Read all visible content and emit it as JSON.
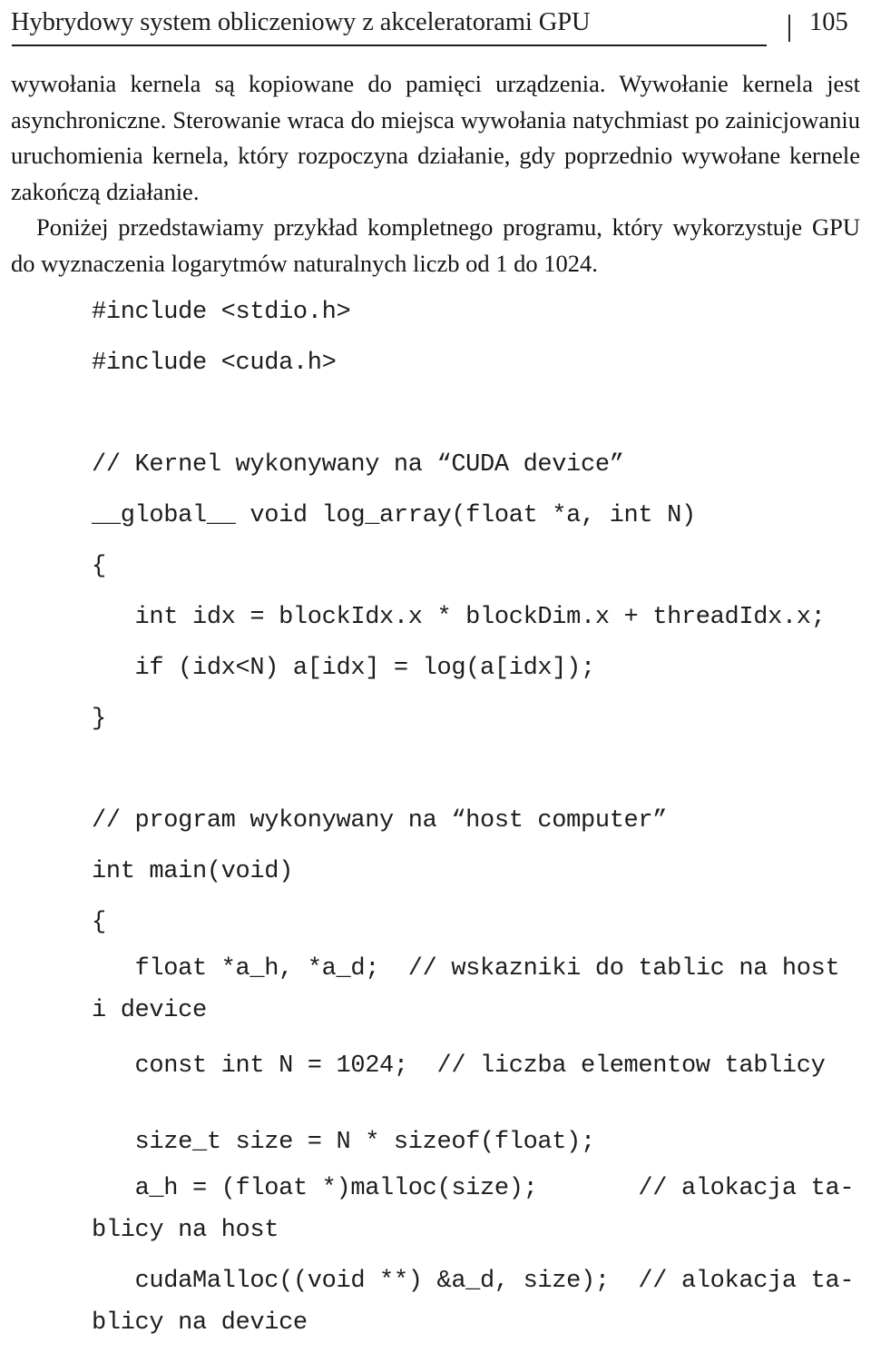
{
  "running_head": {
    "title": "Hybrydowy system obliczeniowy z akceleratorami GPU",
    "separator": "|",
    "page_number": "105"
  },
  "body": {
    "paragraphs": [
      {
        "indent": false,
        "text": "wywołania kernela są kopiowane do pamięci urządzenia. Wywołanie kernela jest asynchroniczne. Sterowanie wraca do miejsca wywołania natychmiast po zainicjowaniu uruchomienia kernela, który rozpoczyna działanie, gdy poprzednio wywołane kernele zakończą działanie."
      },
      {
        "indent": true,
        "text": "Poniżej przedstawiamy przykład kompletnego programu, który wykorzystuje GPU do wyznaczenia logarytmów naturalnych liczb od 1 do 1024."
      }
    ]
  },
  "listing": {
    "language": "CUDA C",
    "lines": [
      {
        "id": "l01",
        "text": "#include <stdio.h>",
        "kind": "code"
      },
      {
        "id": "l02",
        "text": "#include <cuda.h>",
        "kind": "code"
      },
      {
        "id": "l03",
        "text": "",
        "kind": "blank"
      },
      {
        "id": "l04",
        "text": "// Kernel wykonywany na “CUDA device”",
        "kind": "comment"
      },
      {
        "id": "l05",
        "text": "__global__ void log_array(float *a, int N)",
        "kind": "code"
      },
      {
        "id": "l06",
        "text": "{",
        "kind": "code"
      },
      {
        "id": "l07",
        "text": "   int idx = blockIdx.x * blockDim.x + threadIdx.x;",
        "kind": "code"
      },
      {
        "id": "l08",
        "text": "   if (idx<N) a[idx] = log(a[idx]);",
        "kind": "code"
      },
      {
        "id": "l09",
        "text": "}",
        "kind": "code"
      },
      {
        "id": "l10",
        "text": "",
        "kind": "blank"
      },
      {
        "id": "l11",
        "text": "// program wykonywany na “host computer”",
        "kind": "comment"
      },
      {
        "id": "l12",
        "text": "int main(void)",
        "kind": "code"
      },
      {
        "id": "l13",
        "text": "{",
        "kind": "code"
      },
      {
        "id": "l14",
        "text": "   float *a_h, *a_d;  // wskazniki do tablic na host i device",
        "kind": "wrapped"
      },
      {
        "id": "l15",
        "text": "   const int N = 1024;  // liczba elementow tablicy",
        "kind": "code"
      },
      {
        "id": "l16",
        "text": "",
        "kind": "halfblank"
      },
      {
        "id": "l17",
        "text": "   size_t size = N * sizeof(float);",
        "kind": "code"
      },
      {
        "id": "l18",
        "text": "   a_h = (float *)malloc(size);       // alokacja ta-blicy na host",
        "kind": "wrapped"
      },
      {
        "id": "l19",
        "text": "   cudaMalloc((void **) &a_d, size);  // alokacja ta-blicy na device",
        "kind": "wrapped"
      }
    ]
  }
}
